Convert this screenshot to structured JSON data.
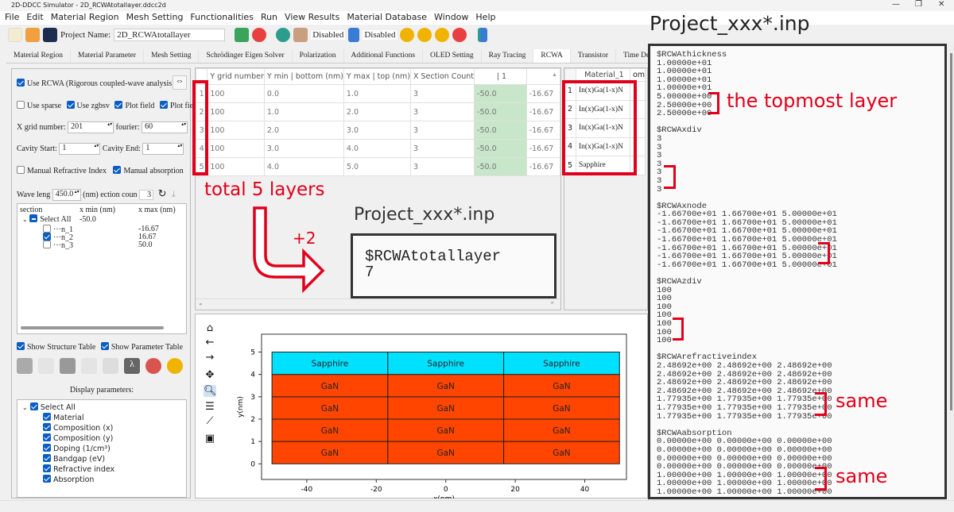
{
  "window": {
    "title": "2D-DDCC Simulator - 2D_RCWAtotallayer.ddcc2d",
    "controls": [
      "—",
      "❐",
      "✕"
    ]
  },
  "menu": [
    "File",
    "Edit",
    "Material Region",
    "Mesh Setting",
    "Functionalities",
    "Run",
    "View Results",
    "Material Database",
    "Window",
    "Help"
  ],
  "toolbar": {
    "project_label": "Project Name:",
    "project_name": "2D_RCWAtotallayer",
    "disabled1": "Disabled",
    "disabled2": "Disabled"
  },
  "tabs": [
    "Material Region",
    "Material Parameter",
    "Mesh Setting",
    "Schrödinger Eigen Solver",
    "Polarization",
    "Additional Functions",
    "OLED Setting",
    "Ray Tracing",
    "RCWA",
    "Transistor",
    "Time Dependent Mo"
  ],
  "active_tab": "RCWA",
  "left": {
    "use_rcwa": "Use RCWA (Rigorous coupled-wave analysis)",
    "use_sparse": "Use sparse",
    "use_zgbsv": "Use zgbsv",
    "plot_field1": "Plot field",
    "plot_field2": "Plot field",
    "x_grid_label": "X grid number:",
    "x_grid": "201",
    "fourier_label": "fourier:",
    "fourier": "60",
    "cavity_start_label": "Cavity Start:",
    "cavity_start": "1",
    "cavity_end_label": "Cavity End:",
    "cavity_end": "1",
    "manual_ri": "Manual Refractive Index",
    "manual_abs": "Manual absorption",
    "wave_label": "Wave leng",
    "wave": "450.0",
    "nm": "(nm)",
    "section_label": "ection coun",
    "section_count": "3",
    "section_headers": [
      "section",
      "x min (nm)",
      "x max (nm)"
    ],
    "select_all": "Select All",
    "select_all_xmin": "-50.0",
    "sections": [
      {
        "name": "···n_1",
        "xmax": "-16.67",
        "checked": false
      },
      {
        "name": "···n_2",
        "xmax": "16.67",
        "checked": true
      },
      {
        "name": "···n_3",
        "xmax": "50.0",
        "checked": false
      }
    ],
    "show_structure": "Show Structure Table",
    "show_parameter": "Show Parameter Table",
    "display_params_label": "Display parameters:",
    "display_params": [
      "Material",
      "Composition (x)",
      "Composition (y)",
      "Doping (1/cm³)",
      "Bandgap (eV)",
      "Refractive index",
      "Absorption"
    ]
  },
  "structure_table": {
    "headers": [
      "Y grid number",
      "Y min | bottom (nm)",
      "Y max | top (nm)",
      "X Section Count",
      "| 1",
      ""
    ],
    "rows": [
      [
        "1",
        "100",
        "0.0",
        "1.0",
        "3",
        "-50.0",
        "-16.67"
      ],
      [
        "2",
        "100",
        "1.0",
        "2.0",
        "3",
        "-50.0",
        "-16.67"
      ],
      [
        "3",
        "100",
        "2.0",
        "3.0",
        "3",
        "-50.0",
        "-16.67"
      ],
      [
        "4",
        "100",
        "3.0",
        "4.0",
        "3",
        "-50.0",
        "-16.67"
      ],
      [
        "5",
        "100",
        "4.0",
        "5.0",
        "3",
        "-50.0",
        "-16.67"
      ]
    ]
  },
  "material_table": {
    "headers": [
      "Material_1",
      "om"
    ],
    "rows": [
      [
        "1",
        "In(x)Ga(1-x)N"
      ],
      [
        "2",
        "In(x)Ga(1-x)N"
      ],
      [
        "3",
        "In(x)Ga(1-x)N"
      ],
      [
        "4",
        "In(x)Ga(1-x)N"
      ],
      [
        "5",
        "Sapphire"
      ]
    ]
  },
  "chart_data": {
    "type": "heatmap",
    "xlabel": "x(nm)",
    "ylabel": "y(nm)",
    "xlim": [
      -53,
      52
    ],
    "ylim": [
      -0.7,
      5.8
    ],
    "xticks": [
      -40,
      -20,
      0,
      20,
      40
    ],
    "yticks": [
      0,
      1,
      2,
      3,
      4,
      5
    ],
    "x_sections": [
      -50,
      -16.67,
      16.67,
      50
    ],
    "layers": [
      {
        "ymin": 0,
        "ymax": 1,
        "material": "GaN",
        "color": "#ff4500"
      },
      {
        "ymin": 1,
        "ymax": 2,
        "material": "GaN",
        "color": "#ff4500"
      },
      {
        "ymin": 2,
        "ymax": 3,
        "material": "GaN",
        "color": "#ff4500"
      },
      {
        "ymin": 3,
        "ymax": 4,
        "material": "GaN",
        "color": "#ff4500"
      },
      {
        "ymin": 4,
        "ymax": 5,
        "material": "Sapphire",
        "color": "#00e1ff"
      }
    ]
  },
  "annotations": {
    "file_title": "Project_xxx*.inp",
    "total_layers": "total 5 layers",
    "plus": "+2",
    "small_file_title": "Project_xxx*.inp",
    "totallayer_key": "$RCWAtotallayer",
    "totallayer_val": "7",
    "topmost": "the topmost layer",
    "same1": "same",
    "same2": "same",
    "accent": "#e0001b"
  },
  "inp_file": [
    "$RCWAthickness",
    "1.00000e+01",
    "1.00000e+01",
    "1.00000e+01",
    "1.00000e+01",
    "5.00000e+00",
    "2.50000e+00",
    "2.50000e+00",
    "",
    "$RCWAxdiv",
    "3",
    "3",
    "3",
    "3",
    "3",
    "3",
    "3",
    "",
    "$RCWAxnode",
    "-1.66700e+01 1.66700e+01 5.00000e+01",
    "-1.66700e+01 1.66700e+01 5.00000e+01",
    "-1.66700e+01 1.66700e+01 5.00000e+01",
    "-1.66700e+01 1.66700e+01 5.00000e+01",
    "-1.66700e+01 1.66700e+01 5.00000e+01",
    "-1.66700e+01 1.66700e+01 5.00000e+01",
    "-1.66700e+01 1.66700e+01 5.00000e+01",
    "",
    "$RCWAzdiv",
    "100",
    "100",
    "100",
    "100",
    "100",
    "100",
    "100",
    "",
    "$RCWArefractiveindex",
    "2.48692e+00 2.48692e+00 2.48692e+00",
    "2.48692e+00 2.48692e+00 2.48692e+00",
    "2.48692e+00 2.48692e+00 2.48692e+00",
    "2.48692e+00 2.48692e+00 2.48692e+00",
    "1.77935e+00 1.77935e+00 1.77935e+00",
    "1.77935e+00 1.77935e+00 1.77935e+00",
    "1.77935e+00 1.77935e+00 1.77935e+00",
    "",
    "$RCWAabsorption",
    "0.00000e+00 0.00000e+00 0.00000e+00",
    "0.00000e+00 0.00000e+00 0.00000e+00",
    "0.00000e+00 0.00000e+00 0.00000e+00",
    "0.00000e+00 0.00000e+00 0.00000e+00",
    "1.00000e+00 1.00000e+00 1.00000e+00",
    "1.00000e+00 1.00000e+00 1.00000e+00",
    "1.00000e+00 1.00000e+00 1.00000e+00"
  ]
}
